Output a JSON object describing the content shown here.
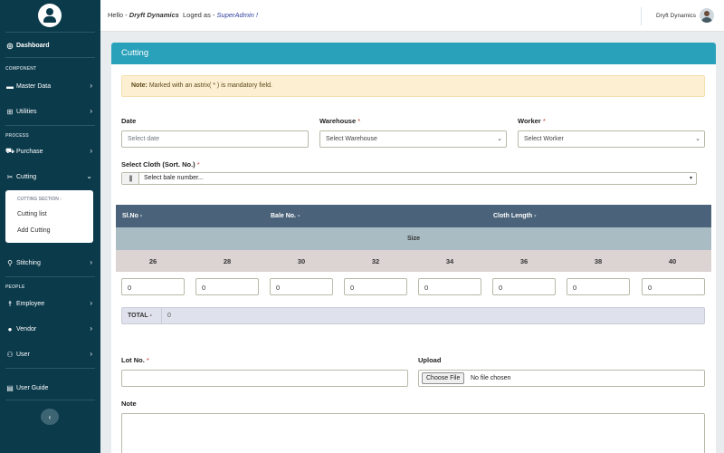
{
  "sidebar": {
    "dashboard": "Dashboard",
    "section_component": "COMPONENT",
    "master_data": "Master Data",
    "utilities": "Utilities",
    "section_process": "PROCESS",
    "purchase": "Purchase",
    "cutting": "Cutting",
    "submenu_title": "CUTTING SECTION :",
    "cutting_list": "Cutting list",
    "add_cutting": "Add Cutting",
    "stitching": "Stitching",
    "section_people": "PEOPLE",
    "employee": "Employee",
    "vendor": "Vendor",
    "user": "User",
    "user_guide": "User Guide",
    "collapse_icon": "chevron-left-icon"
  },
  "topbar": {
    "hello": "Hello -",
    "company": "Dryft Dynamics",
    "logged_as": "Loged as -",
    "role": "SuperAdmin !",
    "username": "Dryft Dynamics"
  },
  "card": {
    "title": "Cutting",
    "note_label": "Note:",
    "note_text": " Marked with an astrix( * ) is mandatory field."
  },
  "form": {
    "date_label": "Date",
    "date_placeholder": "Select date",
    "warehouse_label": "Warehouse",
    "warehouse_value": "Select Warehouse",
    "worker_label": "Worker",
    "worker_value": "Select Worker",
    "cloth_label": "Select Cloth (Sort. No.)",
    "bale_value": "Select bale number...",
    "required_mark": "*",
    "lot_label": "Lot No.",
    "upload_label": "Upload",
    "choose_file": "Choose File",
    "no_file": "No file chosen",
    "note_label": "Note"
  },
  "table": {
    "col_slno": "Sl.No -",
    "col_bale": "Bale No. -",
    "col_length": "Cloth Length -",
    "size_header": "Size",
    "sizes": [
      "26",
      "28",
      "30",
      "32",
      "34",
      "36",
      "38",
      "40"
    ],
    "quantities": [
      "0",
      "0",
      "0",
      "0",
      "0",
      "0",
      "0",
      "0"
    ],
    "total_label": "TOTAL -",
    "total_value": "0"
  },
  "colors": {
    "sidebar": "#0b3a4b",
    "header": "#2aa1ba",
    "table_header": "#4b637a"
  }
}
